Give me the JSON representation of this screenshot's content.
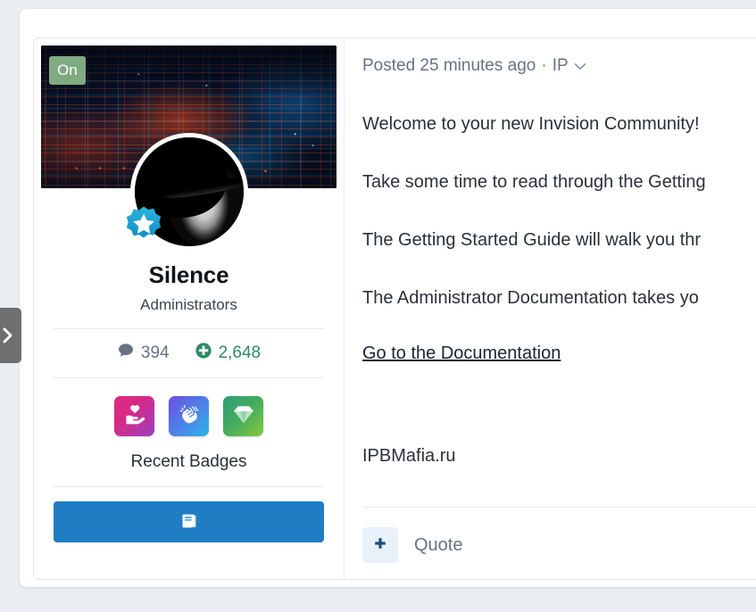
{
  "edge_handle": {
    "icon": "chevron-right-icon"
  },
  "author": {
    "status_badge": "On",
    "display_name": "Silence",
    "group": "Administrators",
    "avatar_alt": "hooded-figure-avatar",
    "cover_alt": "circuit-board-cover-photo",
    "verified_icon": "verified-star-badge-icon",
    "stats": [
      {
        "icon": "comment-icon",
        "value": "394",
        "kind": "posts"
      },
      {
        "icon": "plus-circle-icon",
        "value": "2,648",
        "kind": "reputation"
      }
    ],
    "badges": [
      {
        "icon": "heart-in-hand-icon",
        "color": "#d62a86"
      },
      {
        "icon": "clapping-hands-icon",
        "color": "#4f7fe8"
      },
      {
        "icon": "gem-icon",
        "color": "#46ad5c"
      }
    ],
    "badges_caption": "Recent Badges",
    "action_button": {
      "icon": "book-icon",
      "label": ""
    }
  },
  "post": {
    "meta": {
      "posted": "Posted 25 minutes ago",
      "separator": "·",
      "ip_label": "IP",
      "ip_chevron": "chevron-down-icon"
    },
    "paragraphs": [
      "Welcome to your new Invision Community!",
      "Take some time to read through the Getting",
      "The Getting Started Guide will walk you thr",
      "The Administrator Documentation takes yo"
    ],
    "link": "Go to the Documentation",
    "signature": "IPBMafia.ru",
    "footer": {
      "multiquote_icon": "plus-icon",
      "quote_label": "Quote"
    }
  },
  "colors": {
    "page_background": "#eaedf1",
    "card_background": "#ffffff",
    "border": "#e2e5ea",
    "accent_blue": "#1f7dc4",
    "status_green": "#7faa82",
    "reputation_green": "#2e8b62",
    "muted_text": "#6a7183",
    "body_text": "#2b3039"
  }
}
